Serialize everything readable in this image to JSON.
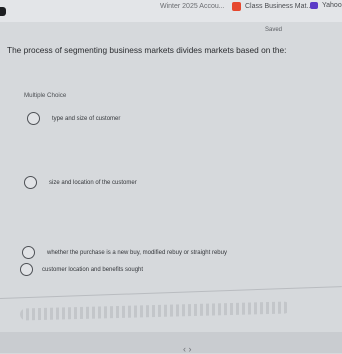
{
  "browser": {
    "tabs": [
      {
        "label": "Winter 2025 Accou...",
        "icon": "page-icon"
      },
      {
        "label": "Class Business Mat...",
        "icon": "mcgraw-hill-icon",
        "color": "#e6472d"
      },
      {
        "label": "Yahoo",
        "icon": "yahoo-icon",
        "color": "#5b3bc7"
      }
    ]
  },
  "status": {
    "saved": "Saved"
  },
  "question": {
    "text": "The process of segmenting business markets divides markets based on the:",
    "type": "Multiple Choice"
  },
  "options": [
    {
      "label": "type and size of customer"
    },
    {
      "label": "size and location of the customer"
    },
    {
      "label": "whether the purchase is a new buy, modified rebuy or straight rebuy"
    },
    {
      "label": "customer location and benefits sought"
    }
  ]
}
